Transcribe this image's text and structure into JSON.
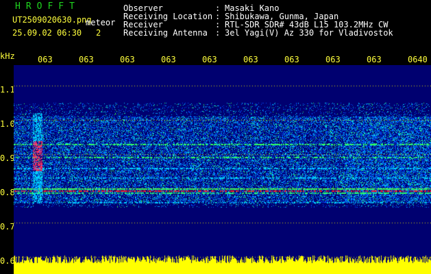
{
  "header": {
    "brand": "HROFFT",
    "filename": "UT2509020630.png",
    "meteor_label": "meteor",
    "datetime": "25.09.02 06:30",
    "count": "2",
    "info": [
      {
        "label": "Observer",
        "sep": ":",
        "value": "Masaki Kano"
      },
      {
        "label": "Receiving Location",
        "sep": ":",
        "value": "Shibukawa, Gunma, Japan"
      },
      {
        "label": "Receiver",
        "sep": ":",
        "value": "RTL-SDR SDR# 43dB L15 103.2MHz CW"
      },
      {
        "label": "Receiving Antenna",
        "sep": ":",
        "value": "3el Yagi(V) Az 330 for Vladivostok"
      }
    ]
  },
  "axis": {
    "y_unit": "kHz",
    "y_ticks": [
      "1.1",
      "1.0",
      "0.9",
      "0.8",
      "0.7",
      "0.6"
    ],
    "x_ticks": [
      "063",
      "063",
      "063",
      "063",
      "063",
      "063",
      "063",
      "063",
      "063",
      "0640"
    ]
  },
  "colors": {
    "background": "#000000",
    "spectrogram_bg": "#000070",
    "noise_low": "#0050ff",
    "noise_mid": "#00d0ff",
    "line_green": "#30ff60",
    "line_red": "#ff2020",
    "meteor": "#ff3060",
    "bottom_band": "#ffff00",
    "axis_text": "#ffff3c"
  }
}
